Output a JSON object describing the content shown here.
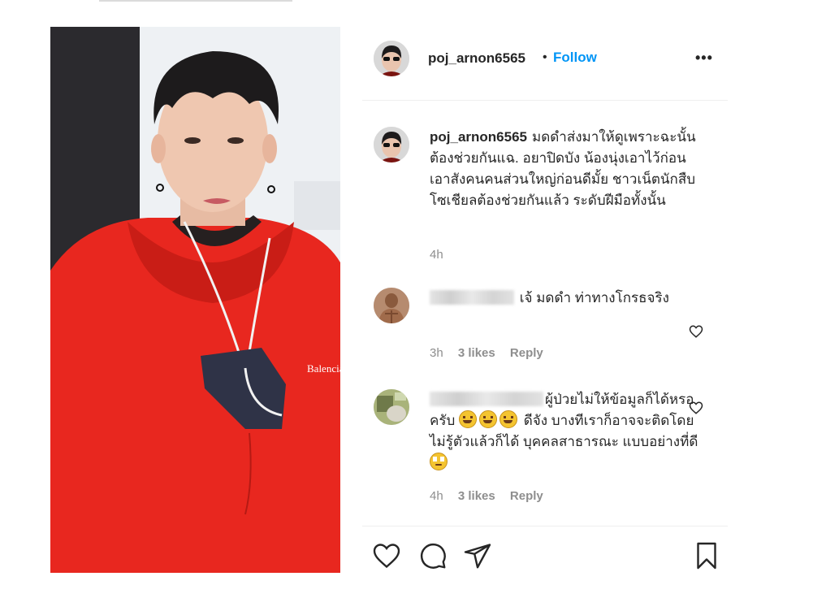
{
  "post": {
    "username": "poj_arnon6565",
    "separator": "•",
    "follow_label": "Follow",
    "more_label": "•••",
    "photo_print": "Balenciaga"
  },
  "caption": {
    "username": "poj_arnon6565",
    "text": "มดดำส่งมาให้ดูเพราะฉะนั้นต้องช่วยกันแฉ. อยาปิดบัง น้องนุ่งเอาไว้ก่อน เอาสังคนคนส่วนใหญ่ก่อนดีมั้ย ชาวเน็ตนักสืบโซเชียลต้องช่วยกันแล้ว ระดับฝีมือทั้งนั้น",
    "time": "4h"
  },
  "comments": [
    {
      "text": "เจ้ มดดำ ท่าทางโกรธจริง",
      "time": "3h",
      "likes": "3 likes",
      "reply_label": "Reply"
    },
    {
      "text_before": "ผู้ป่วยไม่ให้ข้อมูลก็ได้หรอครับ",
      "text_after": "ดีจัง บางทีเราก็อาจจะติดโดยไม่รู้ตัวแล้วก็ได้ บุคคลสาธารณะ แบบอย่างที่ดี",
      "time": "4h",
      "likes": "3 likes",
      "reply_label": "Reply"
    }
  ],
  "icons": {
    "like": "heart-icon",
    "comment": "comment-icon",
    "share": "paper-plane-icon",
    "save": "bookmark-icon"
  },
  "colors": {
    "follow": "#0095f6",
    "text": "#262626",
    "meta": "#8e8e8e",
    "hoodie": "#e8271f"
  }
}
